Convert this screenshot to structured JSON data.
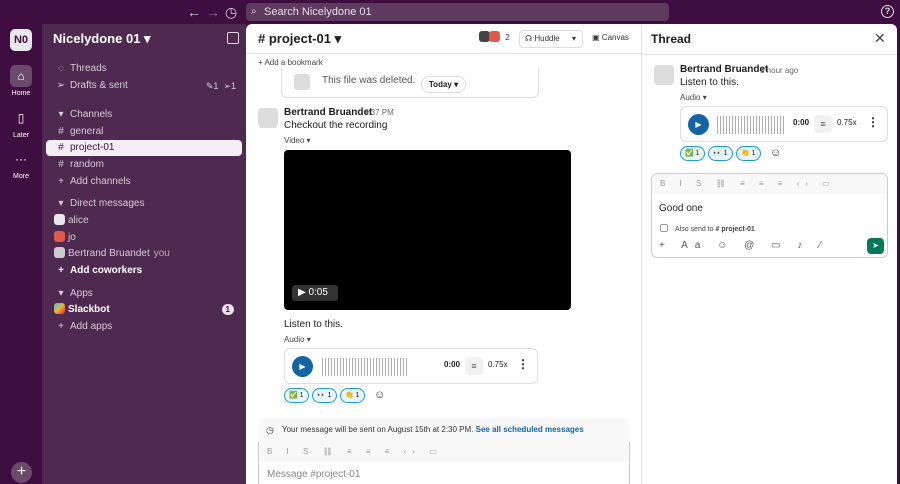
{
  "search": {
    "placeholder": "Search Nicelydone 01"
  },
  "rail": {
    "workspace_initials": "N0",
    "home": "Home",
    "later": "Later",
    "more": "More"
  },
  "sidebar": {
    "workspace": "Nicelydone 01",
    "threads": "Threads",
    "drafts": "Drafts & sent",
    "drafts_counts": [
      "1",
      "1"
    ],
    "channels_header": "Channels",
    "channels": [
      "general",
      "project-01",
      "random"
    ],
    "add_channels": "Add channels",
    "dm_header": "Direct messages",
    "dms": [
      "alice",
      "jo",
      "Bertrand Bruandet"
    ],
    "you": "you",
    "add_coworkers": "Add coworkers",
    "apps_header": "Apps",
    "slackbot": "Slackbot",
    "slackbot_badge": "1",
    "add_apps": "Add apps"
  },
  "main": {
    "channel_title": "# project-01",
    "member_count": "2",
    "huddle": "Huddle",
    "canvas": "Canvas",
    "bookmark": "Add a bookmark",
    "deleted_file": "This file was deleted.",
    "today": "Today",
    "message": {
      "author": "Bertrand Bruandet",
      "time": "4:37 PM",
      "text": "Checkout the recording",
      "video_label": "Video",
      "video_time": "0:05",
      "text2": "Listen to this.",
      "audio_label": "Audio",
      "audio_time": "0:00",
      "speed": "0.75x",
      "reactions": [
        "1",
        "1",
        "1"
      ]
    },
    "scheduled": "Your message will be sent on August 15th at 2:30 PM.",
    "scheduled_link": "See all scheduled messages",
    "composer_placeholder": "Message #project-01"
  },
  "thread": {
    "title": "Thread",
    "author": "Bertrand Bruandet",
    "time": "1 hour ago",
    "text": "Listen to this.",
    "audio_label": "Audio",
    "audio_time": "0:00",
    "speed": "0.75x",
    "reactions": [
      "1",
      "1",
      "1"
    ],
    "reply_text": "Good one",
    "also_send": "Also send to",
    "also_channel": "# project-01"
  }
}
